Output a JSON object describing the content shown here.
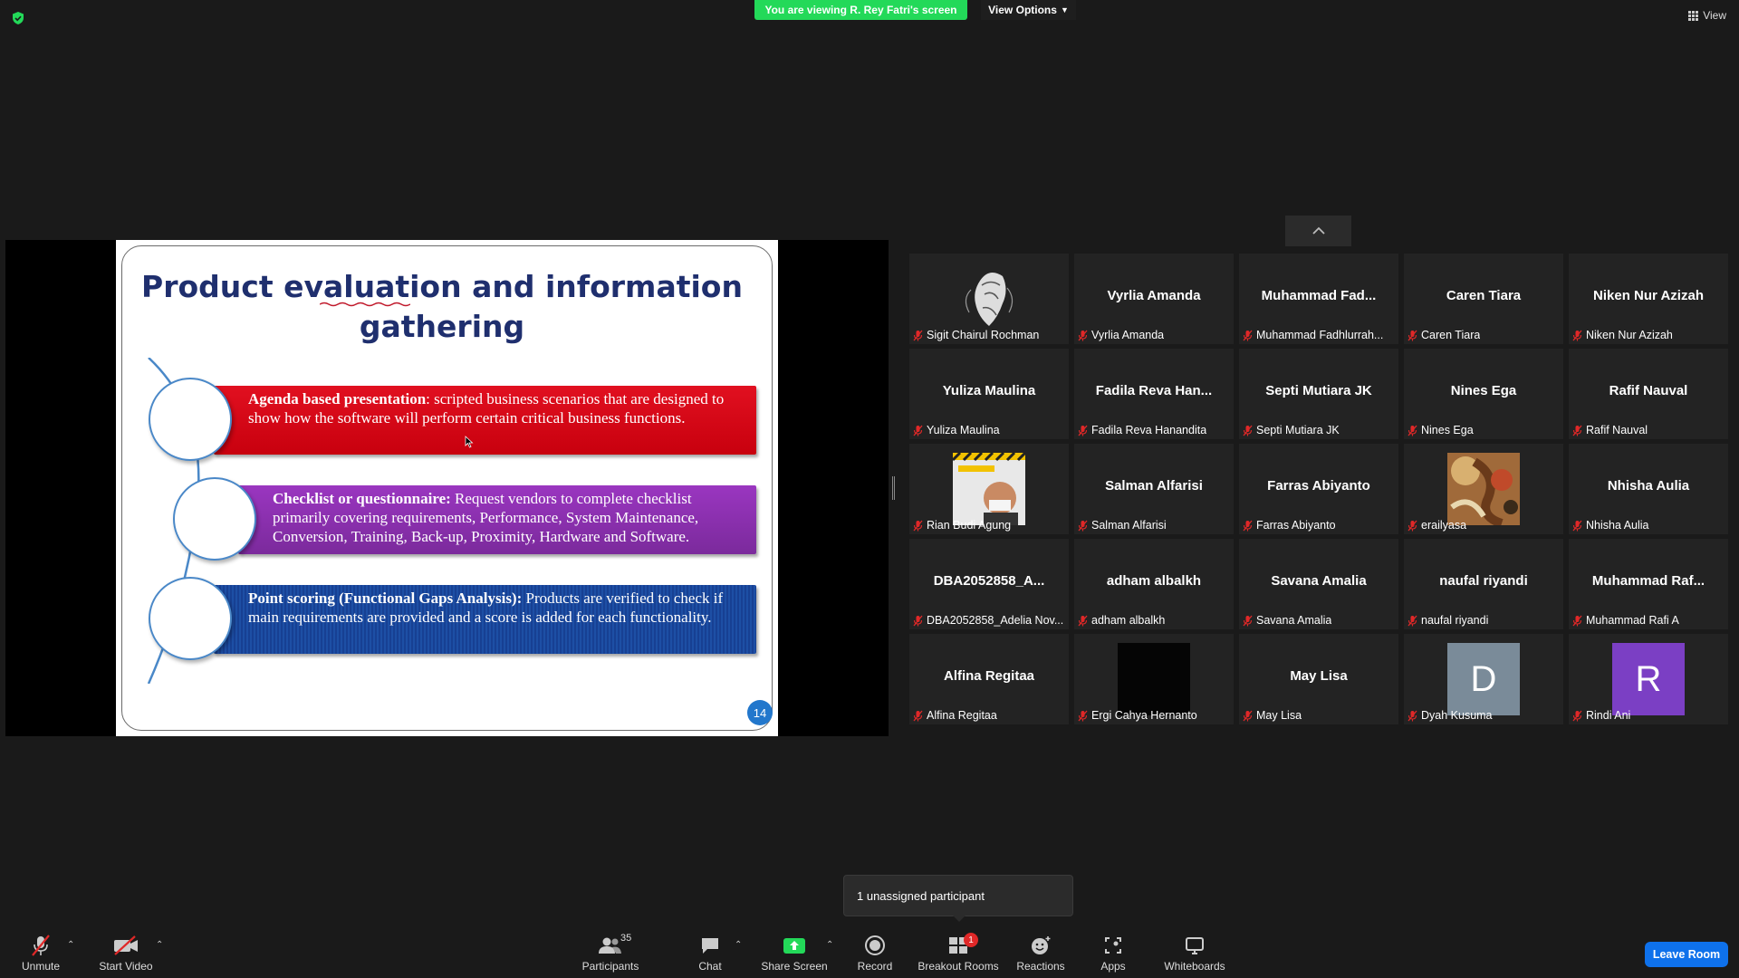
{
  "banner": {
    "viewing": "You are viewing R. Rey Fatri's screen",
    "view_options": "View Options",
    "view": "View"
  },
  "slide": {
    "title_line1": "Product evaluation and information",
    "title_line2": "gathering",
    "items": [
      {
        "heading": "Agenda based presentation",
        "text": ": scripted business scenarios that are designed to show how the software will perform certain critical business functions.",
        "color": "#c8000e"
      },
      {
        "heading": "Checklist or questionnaire:",
        "text": " Request vendors to complete checklist primarily covering requirements, Performance, System Maintenance, Conversion, Training, Back-up, Proximity, Hardware and Software.",
        "color": "#7b2a9c"
      },
      {
        "heading": "Point scoring (Functional Gaps Analysis):",
        "text": " Products are verified to check if main requirements are provided and a score is added for each functionality.",
        "color": "#174093"
      }
    ],
    "page_number": "14"
  },
  "participants": [
    {
      "big": "",
      "name": "Sigit Chairul Rochman",
      "thumb": "sketch"
    },
    {
      "big": "Vyrlia Amanda",
      "name": "Vyrlia Amanda"
    },
    {
      "big": "Muhammad  Fad...",
      "name": "Muhammad Fadhlurrah..."
    },
    {
      "big": "Caren Tiara",
      "name": "Caren Tiara"
    },
    {
      "big": "Niken Nur Azizah",
      "name": "Niken Nur Azizah"
    },
    {
      "big": "Yuliza Maulina",
      "name": "Yuliza Maulina"
    },
    {
      "big": "Fadila  Reva  Han...",
      "name": "Fadila Reva Hanandita"
    },
    {
      "big": "Septi Mutiara JK",
      "name": "Septi Mutiara JK"
    },
    {
      "big": "Nines Ega",
      "name": "Nines Ega"
    },
    {
      "big": "Rafif Nauval",
      "name": "Rafif Nauval"
    },
    {
      "big": "",
      "name": "Rian Budi Agung",
      "thumb": "construction"
    },
    {
      "big": "Salman Alfarisi",
      "name": "Salman Alfarisi"
    },
    {
      "big": "Farras Abiyanto",
      "name": "Farras Abiyanto"
    },
    {
      "big": "",
      "name": "erailyasa",
      "thumb": "painting"
    },
    {
      "big": "Nhisha Aulia",
      "name": "Nhisha Aulia"
    },
    {
      "big": "DBA2052858_A...",
      "name": "DBA2052858_Adelia Nov..."
    },
    {
      "big": "adham albalkh",
      "name": "adham albalkh"
    },
    {
      "big": "Savana Amalia",
      "name": "Savana Amalia"
    },
    {
      "big": "naufal riyandi",
      "name": "naufal riyandi"
    },
    {
      "big": "Muhammad  Raf...",
      "name": "Muhammad Rafi A"
    },
    {
      "big": "Alfina Regitaa",
      "name": "Alfina Regitaa"
    },
    {
      "big": "",
      "name": "Ergi Cahya Hernanto",
      "thumb": "black"
    },
    {
      "big": "May Lisa",
      "name": "May Lisa"
    },
    {
      "big": "",
      "name": "Dyah Kusuma",
      "thumb": "letter",
      "letter": "D",
      "color": "#7a8b99"
    },
    {
      "big": "",
      "name": "Rindi Ani",
      "thumb": "letter",
      "letter": "R",
      "color": "#7b3fc4"
    }
  ],
  "tooltip": "1 unassigned participant",
  "toolbar": {
    "unmute": "Unmute",
    "start_video": "Start Video",
    "participants": "Participants",
    "participant_count": "35",
    "chat": "Chat",
    "share_screen": "Share Screen",
    "record": "Record",
    "breakout_rooms": "Breakout Rooms",
    "breakout_badge": "1",
    "reactions": "Reactions",
    "apps": "Apps",
    "whiteboards": "Whiteboards",
    "leave_room": "Leave Room"
  },
  "colors": {
    "accent_green": "#23d959",
    "leave_blue": "#0e71eb",
    "muted_red": "#e02828"
  }
}
